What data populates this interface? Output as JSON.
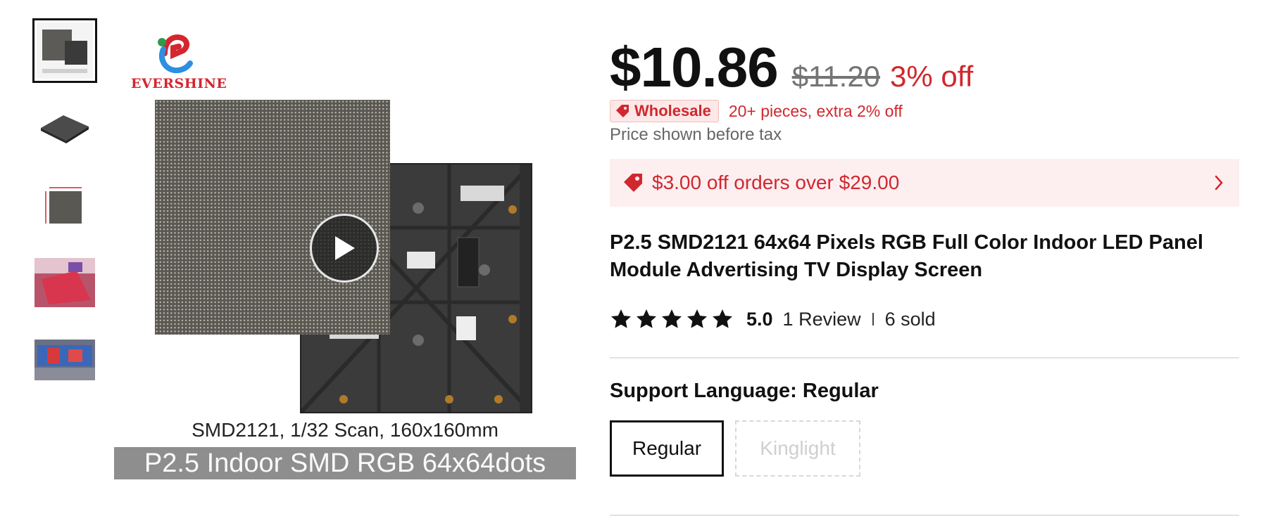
{
  "gallery": {
    "thumbnails": [
      {
        "icon": "led-panel-thumbnail",
        "active": true
      },
      {
        "icon": "led-panel-side-thumbnail",
        "active": false
      },
      {
        "icon": "led-panel-dimensions-thumbnail",
        "active": false
      },
      {
        "icon": "led-screen-stage-thumbnail",
        "active": false
      },
      {
        "icon": "led-screen-wall-thumbnail",
        "active": false
      }
    ],
    "logo_text": "EVERSHINE",
    "caption_line1": "SMD2121, 1/32 Scan, 160x160mm",
    "caption_line2": "P2.5 Indoor SMD RGB 64x64dots",
    "play_icon": "play-icon"
  },
  "pricing": {
    "price": "$10.86",
    "original_price": "$11.20",
    "discount": "3% off",
    "wholesale_badge": "Wholesale",
    "wholesale_text": "20+ pieces, extra 2% off",
    "tax_note": "Price shown before tax",
    "coupon_text": "$3.00 off orders over $29.00",
    "accent_color": "#d0282e"
  },
  "product": {
    "title": "P2.5 SMD2121 64x64 Pixels RGB Full Color Indoor LED Panel Module Advertising TV Display Screen",
    "rating": 5.0,
    "rating_text": "5.0",
    "review_text": "1 Review",
    "sold_text": "6 sold"
  },
  "options": {
    "label": "Support Language: Regular",
    "values": [
      {
        "label": "Regular",
        "selected": true,
        "available": true
      },
      {
        "label": "Kinglight",
        "selected": false,
        "available": false
      }
    ]
  }
}
